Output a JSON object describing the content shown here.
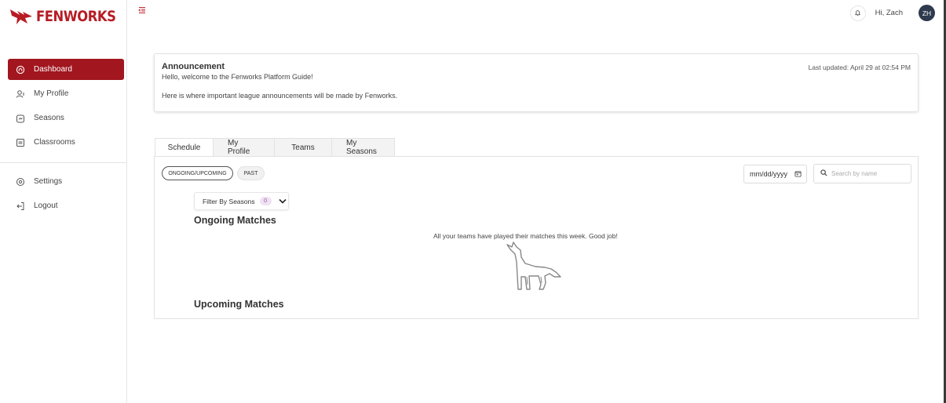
{
  "brand": {
    "name": "FENWORKS",
    "color": "#b71c24"
  },
  "sidebar": {
    "items": [
      {
        "label": "Dashboard",
        "icon": "home-icon",
        "active": true
      },
      {
        "label": "My Profile",
        "icon": "user-icon"
      },
      {
        "label": "Seasons",
        "icon": "calendar-icon"
      },
      {
        "label": "Classrooms",
        "icon": "board-icon"
      }
    ],
    "secondary": [
      {
        "label": "Settings",
        "icon": "settings-icon"
      },
      {
        "label": "Logout",
        "icon": "logout-icon"
      }
    ]
  },
  "header": {
    "greeting": "Hi, Zach",
    "avatar_initials": "ZH"
  },
  "announcement": {
    "title": "Announcement",
    "line1": "Hello, welcome to the Fenworks Platform Guide!",
    "line2": "Here is where important league announcements will be made by Fenworks.",
    "updated": "Last updated: April 29 at 02:54 PM"
  },
  "tabs": [
    {
      "label": "Schedule",
      "active": true
    },
    {
      "label": "My Profile"
    },
    {
      "label": "Teams"
    },
    {
      "label": "My Seasons"
    }
  ],
  "schedule": {
    "toggle_ongoing": "ONGOING/UPCOMING",
    "toggle_past": "PAST",
    "date_placeholder": "mm/dd/yyyy",
    "search_placeholder": "Search by name",
    "filter_label": "Filter By Seasons",
    "filter_count": "0",
    "ongoing_title": "Ongoing Matches",
    "empty_message": "All your teams have played their matches this week. Good job!",
    "upcoming_title": "Upcoming Matches"
  },
  "colors": {
    "accent": "#a1161f",
    "avatar_bg": "#2e3a4d",
    "badge_bg": "#efe2f2",
    "badge_text": "#9b4ab0"
  }
}
